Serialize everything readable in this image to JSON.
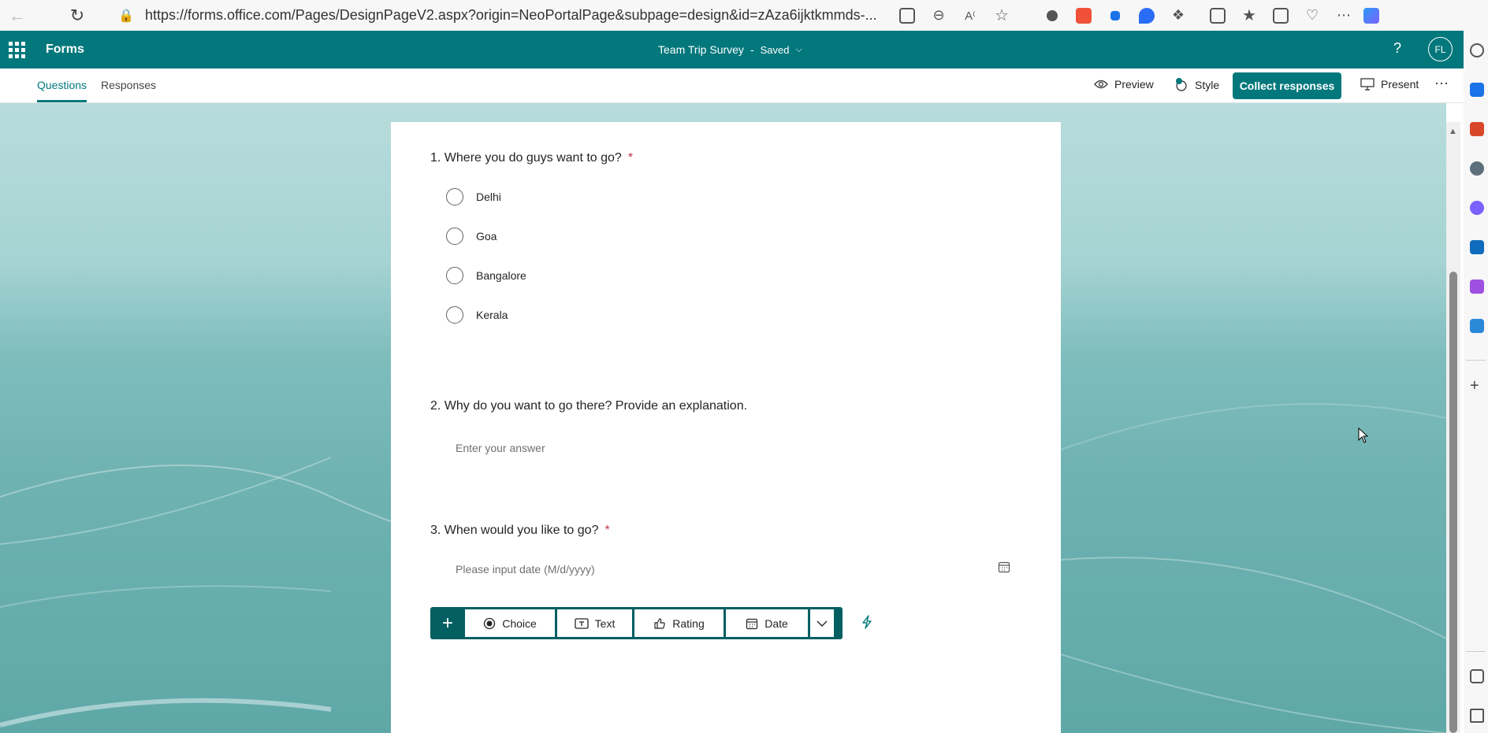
{
  "browser": {
    "url": "https://forms.office.com/Pages/DesignPageV2.aspx?origin=NeoPortalPage&subpage=design&id=zAza6ijktkmmds-..."
  },
  "header": {
    "app_name": "Forms",
    "form_title": "Team Trip Survey",
    "separator": "-",
    "save_status": "Saved",
    "help": "?",
    "avatar_initials": "FL"
  },
  "tabs": {
    "questions": "Questions",
    "responses": "Responses"
  },
  "commands": {
    "preview": "Preview",
    "style": "Style",
    "collect": "Collect responses",
    "present": "Present",
    "more": "···"
  },
  "questions": [
    {
      "title": "1. Where you do guys want to go?",
      "required": "*",
      "options": [
        "Delhi",
        "Goa",
        "Bangalore",
        "Kerala"
      ]
    },
    {
      "title": "2. Why do you want to go there? Provide an explanation.",
      "placeholder": "Enter your answer"
    },
    {
      "title": "3. When would you like to go?",
      "required": "*",
      "placeholder": "Please input date (M/d/yyyy)"
    }
  ],
  "add_toolbar": {
    "plus": "+",
    "choice": "Choice",
    "text": "Text",
    "rating": "Rating",
    "date": "Date"
  },
  "colors": {
    "brand": "#03787c",
    "toolbar": "#035f62",
    "required": "#c4314b"
  }
}
